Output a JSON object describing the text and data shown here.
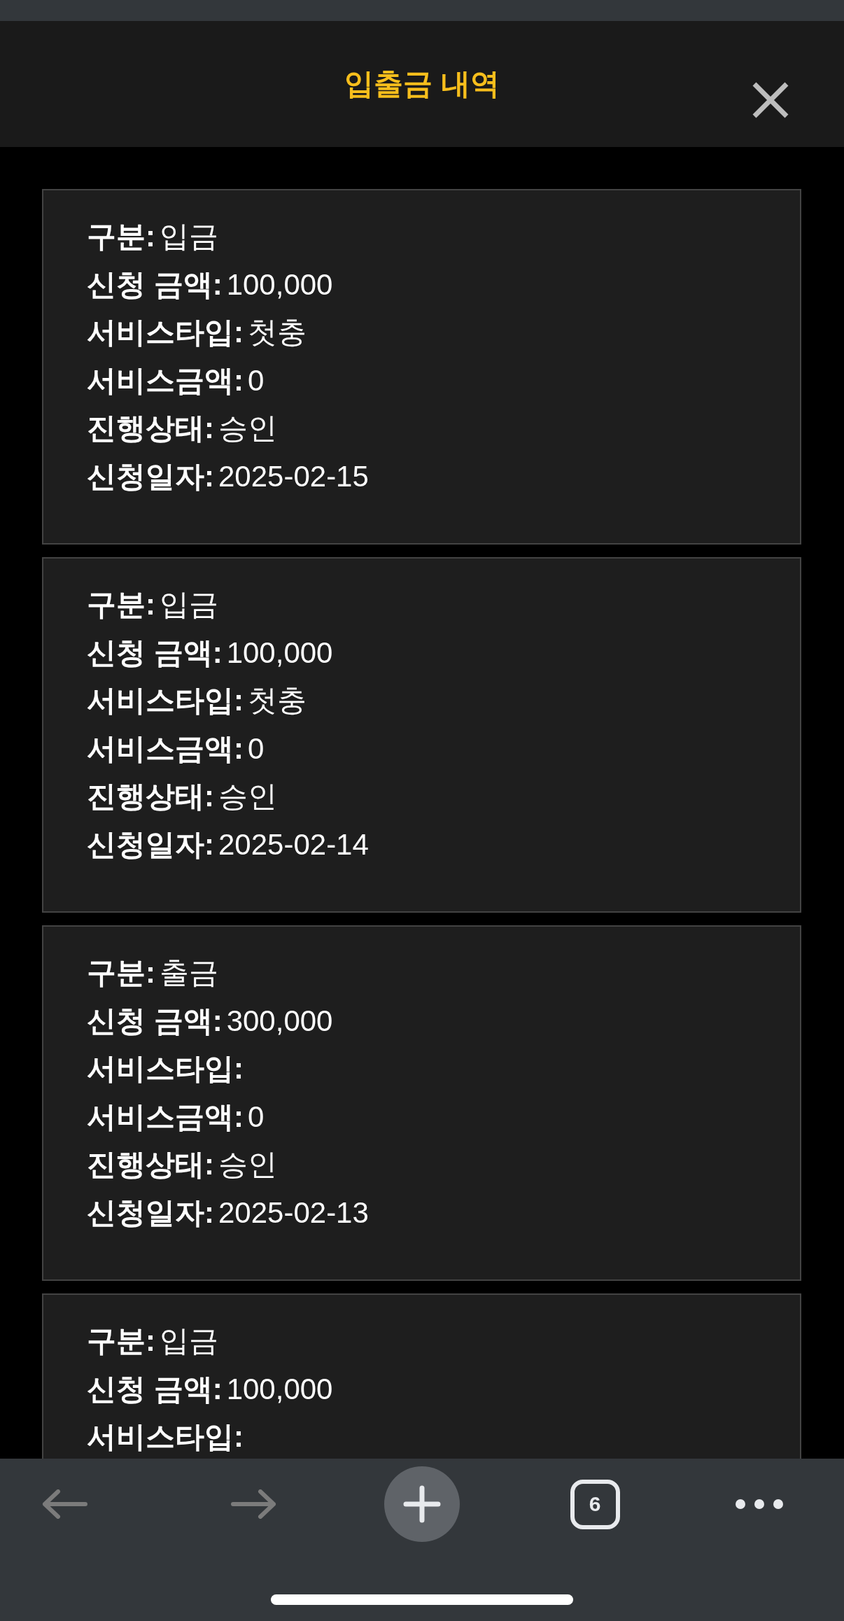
{
  "header": {
    "title": "입출금 내역"
  },
  "records": [
    {
      "fields": [
        {
          "label": "구분:",
          "value": "입금"
        },
        {
          "label": "신청 금액:",
          "value": "100,000"
        },
        {
          "label": "서비스타입:",
          "value": "첫충"
        },
        {
          "label": "서비스금액:",
          "value": "0"
        },
        {
          "label": "진행상태:",
          "value": "승인"
        },
        {
          "label": "신청일자:",
          "value": "2025-02-15"
        }
      ]
    },
    {
      "fields": [
        {
          "label": "구분:",
          "value": "입금"
        },
        {
          "label": "신청 금액:",
          "value": "100,000"
        },
        {
          "label": "서비스타입:",
          "value": "첫충"
        },
        {
          "label": "서비스금액:",
          "value": "0"
        },
        {
          "label": "진행상태:",
          "value": "승인"
        },
        {
          "label": "신청일자:",
          "value": "2025-02-14"
        }
      ]
    },
    {
      "fields": [
        {
          "label": "구분:",
          "value": "출금"
        },
        {
          "label": "신청 금액:",
          "value": "300,000"
        },
        {
          "label": "서비스타입:"
        },
        {
          "label": "서비스금액:",
          "value": "0"
        },
        {
          "label": "진행상태:",
          "value": "승인"
        },
        {
          "label": "신청일자:",
          "value": "2025-02-13"
        }
      ]
    },
    {
      "fields": [
        {
          "label": "구분:",
          "value": "입금"
        },
        {
          "label": "신청 금액:",
          "value": "100,000"
        },
        {
          "label": "서비스타입:"
        }
      ]
    }
  ],
  "toolbar": {
    "back": {
      "disabled": true
    },
    "forward": {
      "disabled": true
    },
    "tab_count": "6"
  }
}
